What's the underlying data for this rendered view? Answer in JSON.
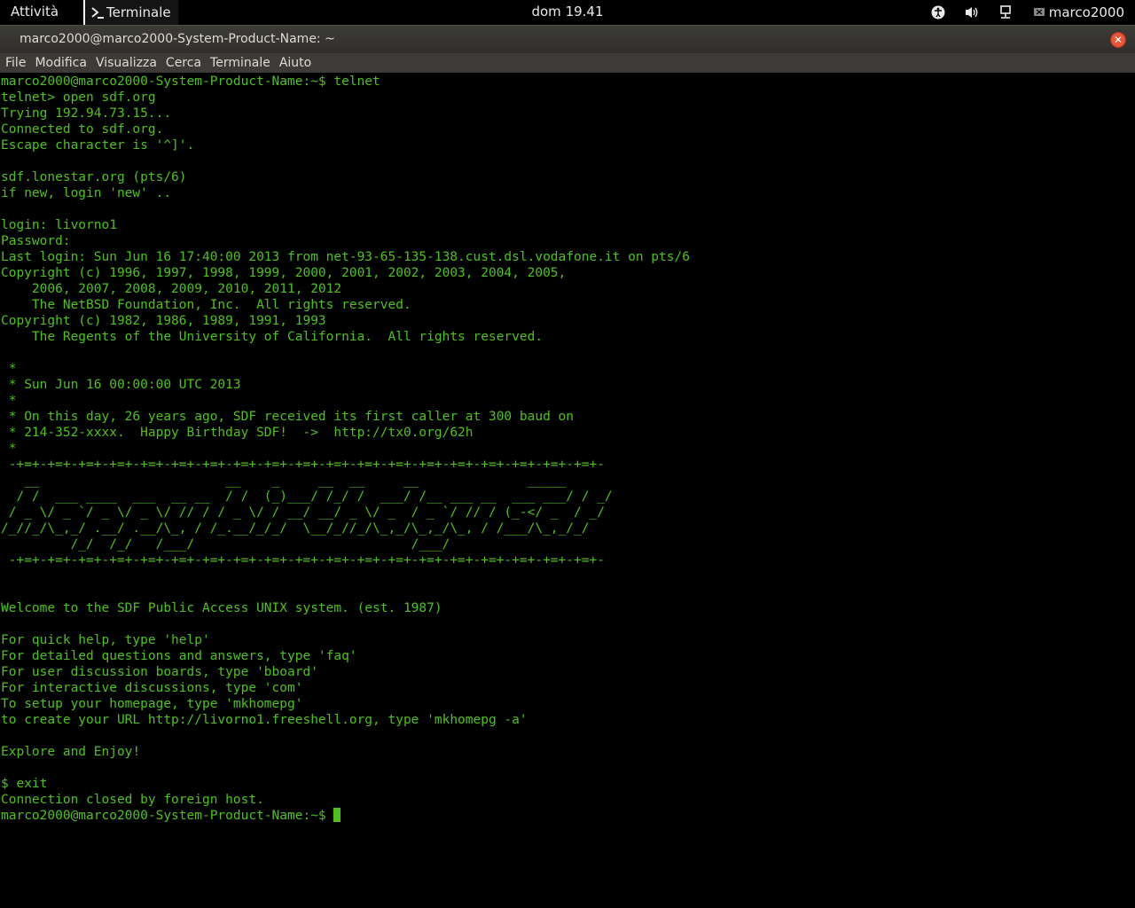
{
  "topbar": {
    "activities": "Attività",
    "app_name": "Terminale",
    "clock": "dom 19.41",
    "user": "marco2000"
  },
  "window": {
    "title": "marco2000@marco2000-System-Product-Name: ~",
    "menu": [
      "File",
      "Modifica",
      "Visualizza",
      "Cerca",
      "Terminale",
      "Aiuto"
    ]
  },
  "terminal": {
    "lines": [
      "marco2000@marco2000-System-Product-Name:~$ telnet",
      "telnet> open sdf.org",
      "Trying 192.94.73.15...",
      "Connected to sdf.org.",
      "Escape character is '^]'.",
      "",
      "sdf.lonestar.org (pts/6)",
      "if new, login 'new' ..",
      "",
      "login: livorno1",
      "Password:",
      "Last login: Sun Jun 16 17:40:00 2013 from net-93-65-135-138.cust.dsl.vodafone.it on pts/6",
      "Copyright (c) 1996, 1997, 1998, 1999, 2000, 2001, 2002, 2003, 2004, 2005,",
      "    2006, 2007, 2008, 2009, 2010, 2011, 2012",
      "    The NetBSD Foundation, Inc.  All rights reserved.",
      "Copyright (c) 1982, 1986, 1989, 1991, 1993",
      "    The Regents of the University of California.  All rights reserved.",
      "",
      " *",
      " * Sun Jun 16 00:00:00 UTC 2013",
      " *",
      " * On this day, 26 years ago, SDF received its first caller at 300 baud on",
      " * 214-352-xxxx.  Happy Birthday SDF!  ->  http://tx0.org/62h",
      " *",
      " -+=+-+=+-+=+-+=+-+=+-+=+-+=+-+=+-+=+-+=+-+=+-+=+-+=+-+=+-+=+-+=+-+=+-+=+-+=+-",
      "   __                        __    _     __  __     __              _____",
      "  / /  ___ ____  ___  __ __  / /  (_)___/ /_/ /  ___/ /__ ___ __  ___ ___/ / _/",
      " / _ \\/ _ `/ _ \\/ _ \\/ // / / _ \\/ / __/ __/ _ \\/ _  / _ `/ // / (_-</ _  / _/",
      "/_//_/\\_,_/ .__/ .__/\\_, / /_.__/_/_/  \\__/_//_/\\_,_/\\_,_/\\_, / /___/\\_,_/_/",
      "         /_/  /_/   /___/                            /___/",
      " -+=+-+=+-+=+-+=+-+=+-+=+-+=+-+=+-+=+-+=+-+=+-+=+-+=+-+=+-+=+-+=+-+=+-+=+-+=+-",
      "",
      "",
      "Welcome to the SDF Public Access UNIX system. (est. 1987)",
      "",
      "For quick help, type 'help'",
      "For detailed questions and answers, type 'faq'",
      "For user discussion boards, type 'bboard'",
      "For interactive discussions, type 'com'",
      "To setup your homepage, type 'mkhomepg'",
      "to create your URL http://livorno1.freeshell.org, type 'mkhomepg -a'",
      "",
      "Explore and Enjoy!",
      "",
      "$ exit",
      "Connection closed by foreign host."
    ],
    "prompt": "marco2000@marco2000-System-Product-Name:~$ "
  }
}
